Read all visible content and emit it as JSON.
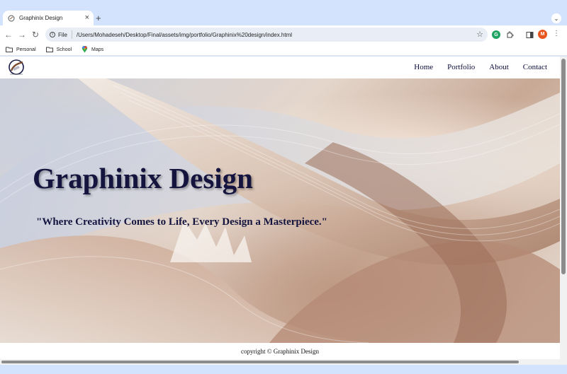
{
  "browser": {
    "tab_title": "Graphinix Design",
    "new_tab_icon": "plus-icon",
    "close_icon": "close-icon",
    "url_chip": "File",
    "url": "/Users/Mohadeseh/Desktop/Final/assets/img/portfolio/Graphinix%20design/index.html",
    "profile_initial": "M",
    "extension_initial": "G",
    "accent_color": "#d3e3fd",
    "profile_color": "#e8541c"
  },
  "bookmarks": [
    {
      "label": "Personal",
      "icon": "folder-icon"
    },
    {
      "label": "School",
      "icon": "folder-icon"
    },
    {
      "label": "Maps",
      "icon": "maps-icon"
    }
  ],
  "site": {
    "nav": [
      "Home",
      "Portfolio",
      "About",
      "Contact"
    ],
    "hero_title": "Graphinix Design",
    "hero_tagline": "\"Where Creativity Comes to Life, Every Design a Masterpiece.\"",
    "footer": "copyright © Graphinix Design",
    "text_color": "#14143f"
  }
}
